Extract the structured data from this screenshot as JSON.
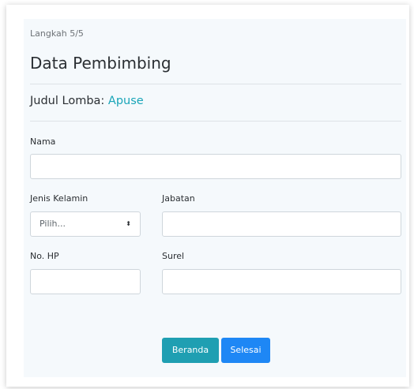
{
  "step": "Langkah 5/5",
  "title": "Data Pembimbing",
  "competition": {
    "label": "Judul Lomba:",
    "value": "Apuse"
  },
  "form": {
    "name_label": "Nama",
    "gender_label": "Jenis Kelamin",
    "gender_selected": "Pilih...",
    "position_label": "Jabatan",
    "phone_label": "No. HP",
    "email_label": "Surel"
  },
  "buttons": {
    "home": "Beranda",
    "finish": "Selesai"
  },
  "colors": {
    "accent_teal": "#1aa5b8",
    "button_home": "#1f9fb2",
    "button_finish": "#1e87f5"
  }
}
